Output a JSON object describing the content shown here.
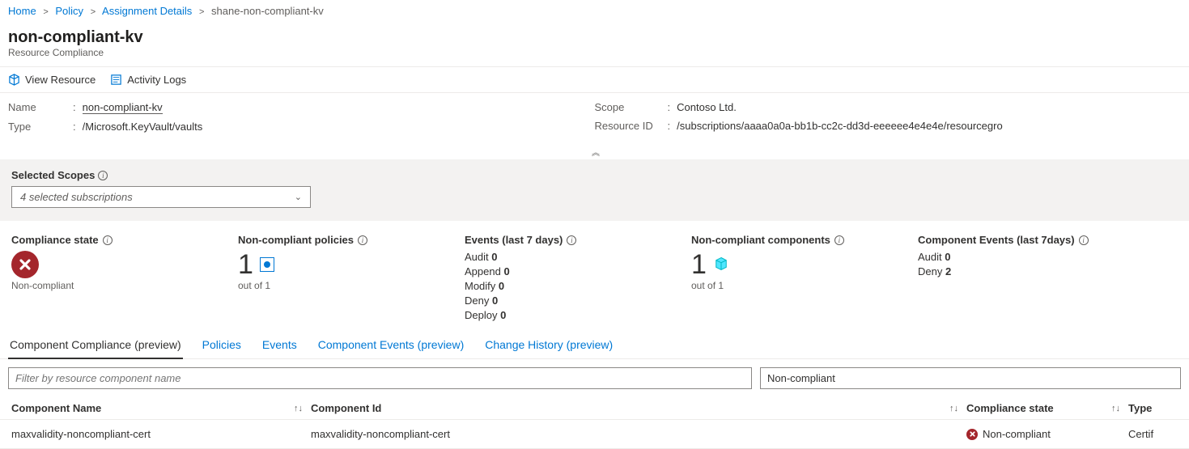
{
  "breadcrumb": {
    "home": "Home",
    "policy": "Policy",
    "assignment": "Assignment Details",
    "current": "shane-non-compliant-kv"
  },
  "header": {
    "title": "non-compliant-kv",
    "subtitle": "Resource Compliance"
  },
  "toolbar": {
    "view_resource": "View Resource",
    "activity_logs": "Activity Logs"
  },
  "props": {
    "name_label": "Name",
    "name_value": "non-compliant-kv",
    "type_label": "Type",
    "type_value": "/Microsoft.KeyVault/vaults",
    "scope_label": "Scope",
    "scope_value": "Contoso Ltd.",
    "resid_label": "Resource ID",
    "resid_value": "/subscriptions/aaaa0a0a-bb1b-cc2c-dd3d-eeeeee4e4e4e/resourcegro"
  },
  "scopes": {
    "title": "Selected Scopes",
    "selected": "4 selected subscriptions"
  },
  "stats": {
    "compliance": {
      "title": "Compliance state",
      "label": "Non-compliant"
    },
    "nc_policies": {
      "title": "Non-compliant policies",
      "num": "1",
      "sub": "out of 1"
    },
    "events": {
      "title": "Events (last 7 days)",
      "audit_l": "Audit",
      "audit_v": "0",
      "append_l": "Append",
      "append_v": "0",
      "modify_l": "Modify",
      "modify_v": "0",
      "deny_l": "Deny",
      "deny_v": "0",
      "deploy_l": "Deploy",
      "deploy_v": "0"
    },
    "nc_comp": {
      "title": "Non-compliant components",
      "num": "1",
      "sub": "out of 1"
    },
    "comp_events": {
      "title": "Component Events (last 7days)",
      "audit_l": "Audit",
      "audit_v": "0",
      "deny_l": "Deny",
      "deny_v": "2"
    }
  },
  "tabs": {
    "t1": "Component Compliance (preview)",
    "t2": "Policies",
    "t3": "Events",
    "t4": "Component Events (preview)",
    "t5": "Change History (preview)"
  },
  "filter": {
    "placeholder": "Filter by resource component name",
    "state": "Non-compliant"
  },
  "table": {
    "h_name": "Component Name",
    "h_id": "Component Id",
    "h_state": "Compliance state",
    "h_type": "Type",
    "rows": [
      {
        "name": "maxvalidity-noncompliant-cert",
        "id": "maxvalidity-noncompliant-cert",
        "state": "Non-compliant",
        "type": "Certif"
      }
    ]
  }
}
